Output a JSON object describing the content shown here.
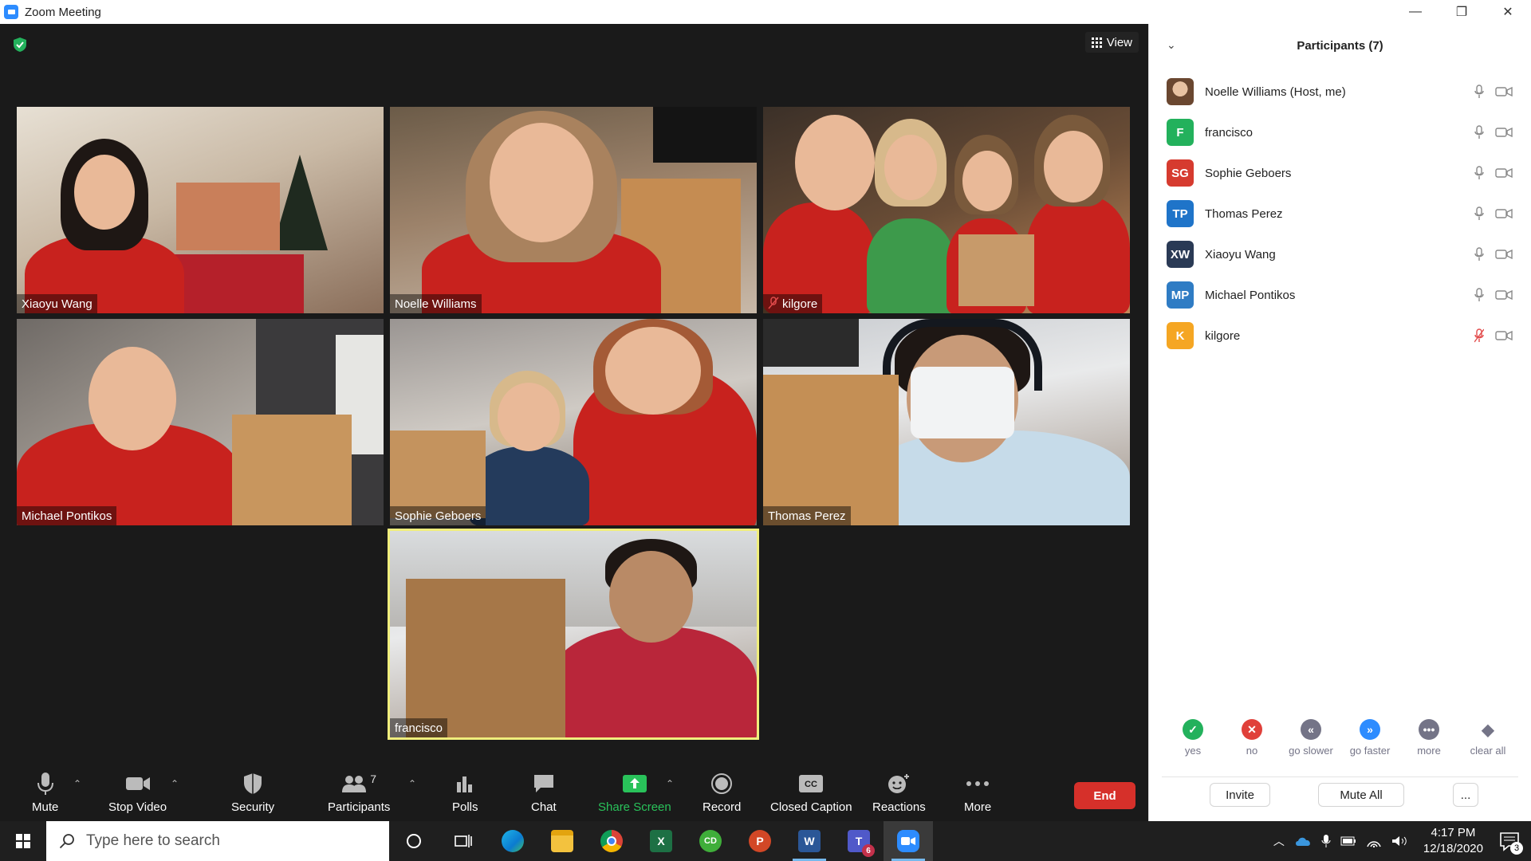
{
  "window": {
    "title": "Zoom Meeting",
    "minimize": "—",
    "restore": "❐",
    "close": "✕"
  },
  "meeting": {
    "view_label": "View",
    "tiles": [
      {
        "name": "Xiaoyu Wang",
        "muted": false,
        "active": false
      },
      {
        "name": "Noelle Williams",
        "muted": false,
        "active": false
      },
      {
        "name": "kilgore",
        "muted": true,
        "active": false
      },
      {
        "name": "Michael Pontikos",
        "muted": false,
        "active": false
      },
      {
        "name": "Sophie Geboers",
        "muted": false,
        "active": false
      },
      {
        "name": "Thomas Perez",
        "muted": false,
        "active": false
      },
      {
        "name": "francisco",
        "muted": false,
        "active": true
      }
    ]
  },
  "toolbar": {
    "mute": "Mute",
    "stop_video": "Stop Video",
    "security": "Security",
    "participants": "Participants",
    "participants_count": "7",
    "polls": "Polls",
    "chat": "Chat",
    "share_screen": "Share Screen",
    "record": "Record",
    "closed_caption": "Closed Caption",
    "reactions": "Reactions",
    "more": "More",
    "end": "End"
  },
  "panel": {
    "title": "Participants (7)",
    "participants": [
      {
        "initials": "",
        "name": "Noelle Williams (Host, me)",
        "color": "",
        "mic_muted": false
      },
      {
        "initials": "F",
        "name": "francisco",
        "color": "#23b15c",
        "mic_muted": false
      },
      {
        "initials": "SG",
        "name": "Sophie Geboers",
        "color": "#d63b2f",
        "mic_muted": false
      },
      {
        "initials": "TP",
        "name": "Thomas Perez",
        "color": "#1f74c9",
        "mic_muted": false
      },
      {
        "initials": "XW",
        "name": "Xiaoyu Wang",
        "color": "#2a3a55",
        "mic_muted": false
      },
      {
        "initials": "MP",
        "name": "Michael Pontikos",
        "color": "#2f7cc4",
        "mic_muted": false
      },
      {
        "initials": "K",
        "name": "kilgore",
        "color": "#f5a623",
        "mic_muted": true
      }
    ],
    "feedback": [
      {
        "label": "yes",
        "symbol": "✓",
        "color": "#23b15c"
      },
      {
        "label": "no",
        "symbol": "✕",
        "color": "#e0403a"
      },
      {
        "label": "go slower",
        "symbol": "«",
        "color": "#747487"
      },
      {
        "label": "go faster",
        "symbol": "»",
        "color": "#2d8cff"
      },
      {
        "label": "more",
        "symbol": "•••",
        "color": "#747487"
      },
      {
        "label": "clear all",
        "symbol": "◆",
        "color": "#747487"
      }
    ],
    "invite": "Invite",
    "mute_all": "Mute All",
    "more": "..."
  },
  "taskbar": {
    "search_placeholder": "Type here to search",
    "time": "4:17 PM",
    "date": "12/18/2020",
    "notification_count": "3",
    "teams_badge": "6"
  },
  "colors": {
    "zoom_blue": "#2d8cff",
    "end_red": "#d6302a",
    "share_green": "#29c25a",
    "active_speaker": "#f0ee7c"
  }
}
